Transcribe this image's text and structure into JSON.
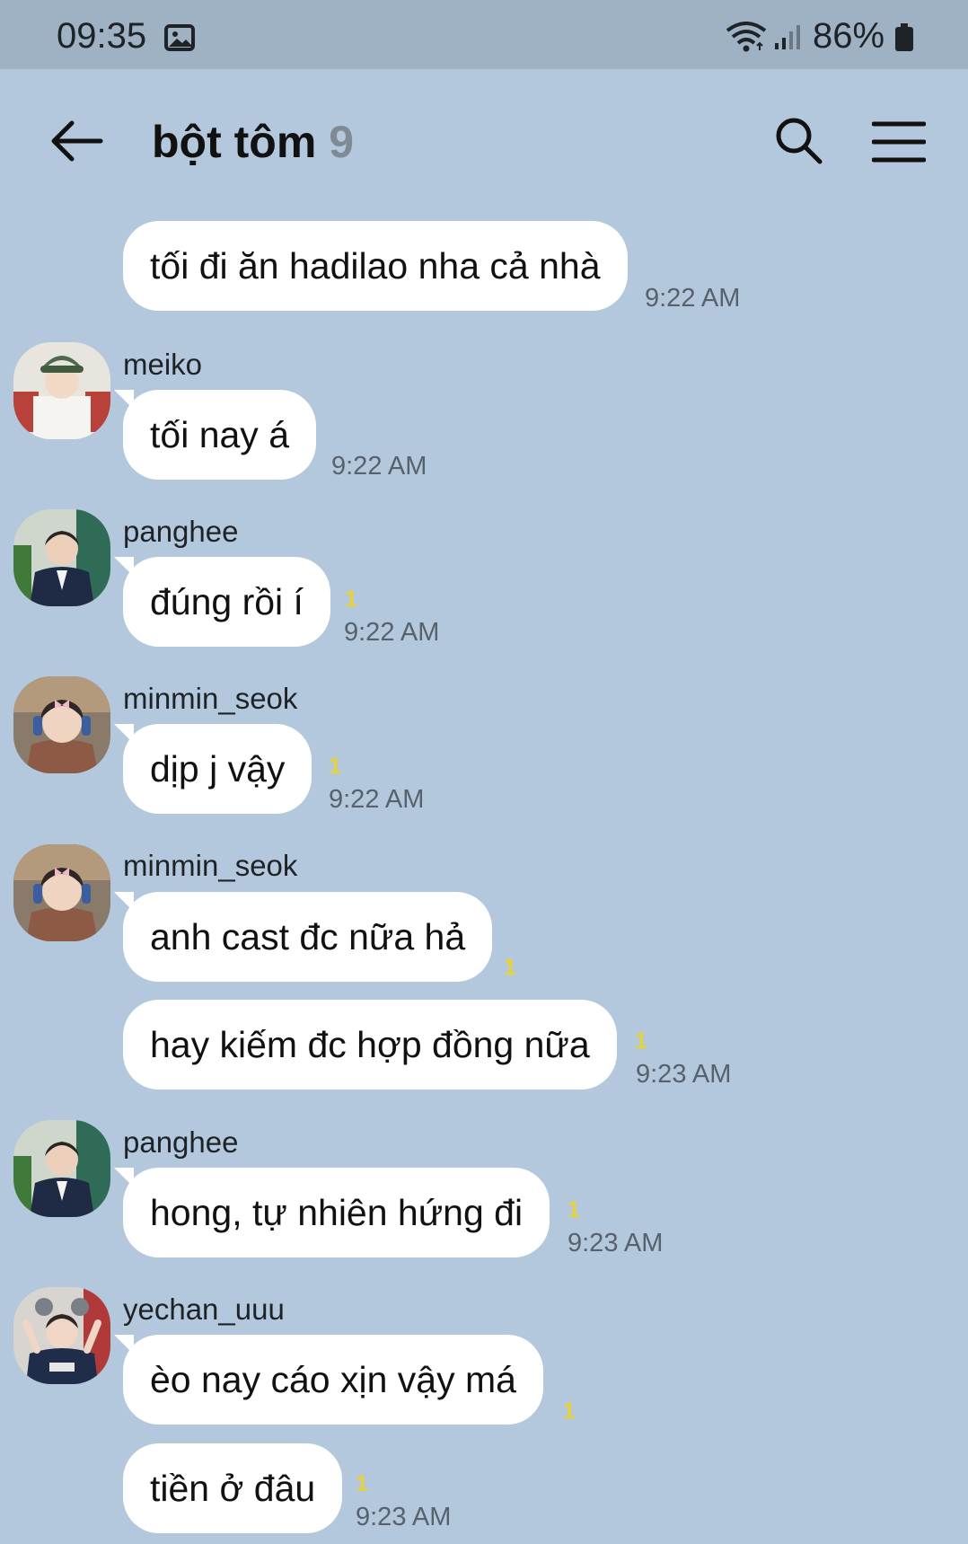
{
  "status_bar": {
    "time": "09:35",
    "battery": "86%",
    "icons": [
      "gallery-icon",
      "wifi-icon",
      "signal-icon",
      "battery-icon"
    ]
  },
  "header": {
    "title": "bột tôm",
    "member_count": "9",
    "icons": [
      "back-arrow-icon",
      "search-icon",
      "menu-icon"
    ]
  },
  "messages": [
    {
      "sender": "",
      "text": "tối đi ăn hadilao nha cả nhà",
      "time": "9:22 AM",
      "unread": ""
    },
    {
      "sender": "meiko",
      "text": "tối nay á",
      "time": "9:22 AM",
      "unread": ""
    },
    {
      "sender": "panghee",
      "text": "đúng rồi í",
      "time": "9:22 AM",
      "unread": "1"
    },
    {
      "sender": "minmin_seok",
      "text": "dịp j vậy",
      "time": "9:22 AM",
      "unread": "1"
    },
    {
      "sender": "minmin_seok",
      "text": "anh cast đc nữa hả",
      "time": "",
      "unread": "1"
    },
    {
      "sender": "",
      "text": "hay kiếm đc hợp đồng nữa",
      "time": "9:23 AM",
      "unread": "1"
    },
    {
      "sender": "panghee",
      "text": "hong, tự nhiên hứng đi",
      "time": "9:23 AM",
      "unread": "1"
    },
    {
      "sender": "yechan_uuu",
      "text": "èo nay cáo xịn vậy má",
      "time": "",
      "unread": "1"
    },
    {
      "sender": "",
      "text": "tiền ở đâu",
      "time": "9:23 AM",
      "unread": "1"
    }
  ],
  "colors": {
    "background": "#b3c8dc",
    "status_bar": "#9fb2c4",
    "bubble": "#ffffff",
    "unread": "#e9d235",
    "member_count": "#7f8a94"
  }
}
